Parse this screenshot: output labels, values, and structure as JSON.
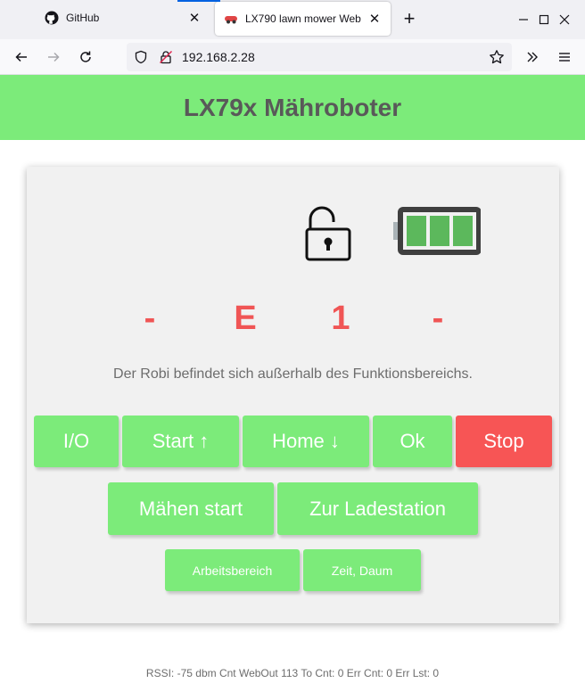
{
  "browser": {
    "tabs": [
      {
        "title": "GitHub",
        "icon": "github-icon"
      },
      {
        "title": "LX790 lawn mower Web",
        "icon": "mower-icon"
      }
    ],
    "url": "192.168.2.28"
  },
  "page": {
    "title": "LX79x Mähroboter",
    "status": {
      "lock_state": "unlocked",
      "battery_bars": 3,
      "battery_bars_max": 3,
      "display": [
        "-",
        "E",
        "1",
        "-"
      ],
      "message": "Der Robi befindet sich außerhalb des Funktionsbereichs."
    },
    "buttons": {
      "io": "I/O",
      "start": "Start ↑",
      "home": "Home ↓",
      "ok": "Ok",
      "stop": "Stop",
      "maehen_start": "Mähen start",
      "zur_ladestation": "Zur Ladestation",
      "arbeitsbereich": "Arbeitsbereich",
      "zeit_datum": "Zeit, Daum"
    },
    "footer": "RSSI: -75 dbm Cnt WebOut 113 To Cnt: 0 Err Cnt: 0 Err Lst: 0"
  },
  "colors": {
    "accent_green": "#7ceb7a",
    "stop_red": "#f75555",
    "display_red": "#f05555",
    "battery_green": "#5cb85c"
  }
}
